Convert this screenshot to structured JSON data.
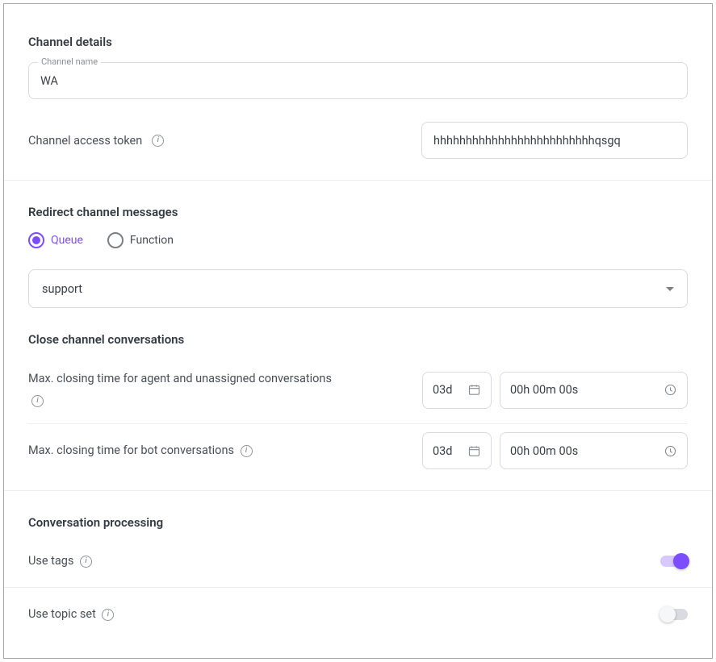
{
  "channel_details": {
    "heading": "Channel details",
    "channel_name": {
      "label": "Channel name",
      "value": "WA"
    },
    "access_token": {
      "label": "Channel access token",
      "value": "hhhhhhhhhhhhhhhhhhhhhhhhhqsgq"
    }
  },
  "redirect": {
    "heading": "Redirect channel messages",
    "options": {
      "queue": "Queue",
      "function": "Function",
      "selected": "queue"
    },
    "selected_value": "support"
  },
  "close": {
    "heading": "Close channel conversations",
    "agent": {
      "label": "Max. closing time for agent and unassigned conversations",
      "days": "03d",
      "time": "00h 00m 00s"
    },
    "bot": {
      "label": "Max. closing time for bot conversations",
      "days": "03d",
      "time": "00h 00m 00s"
    }
  },
  "processing": {
    "heading": "Conversation processing",
    "use_tags": {
      "label": "Use tags",
      "value": true
    },
    "use_topic": {
      "label": "Use topic set",
      "value": false
    }
  }
}
